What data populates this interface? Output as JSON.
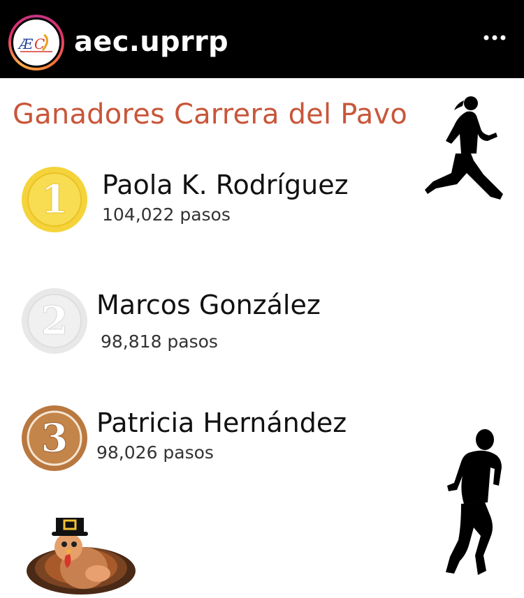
{
  "header": {
    "username": "aec.uprrp",
    "avatar_icon": "aec-logo-icon",
    "menu_icon": "more-options-icon"
  },
  "post": {
    "title": "Ganadores Carrera del Pavo",
    "winners": [
      {
        "place": "1",
        "name": "Paola K. Rodríguez",
        "steps": "104,022 pasos",
        "medal": "gold-medal-icon"
      },
      {
        "place": "2",
        "name": "Marcos González",
        "steps": "98,818 pasos",
        "medal": "silver-medal-icon"
      },
      {
        "place": "3",
        "name": "Patricia Hernández",
        "steps": "98,026 pasos",
        "medal": "bronze-medal-icon"
      }
    ],
    "decorations": [
      "female-runner-icon",
      "male-runner-icon",
      "pilgrim-turkey-icon"
    ]
  },
  "colors": {
    "header_bg": "#000000",
    "title": "#c8563a",
    "gold": "#f5d33a",
    "silver": "#e8e8e8",
    "bronze": "#b9783f"
  }
}
